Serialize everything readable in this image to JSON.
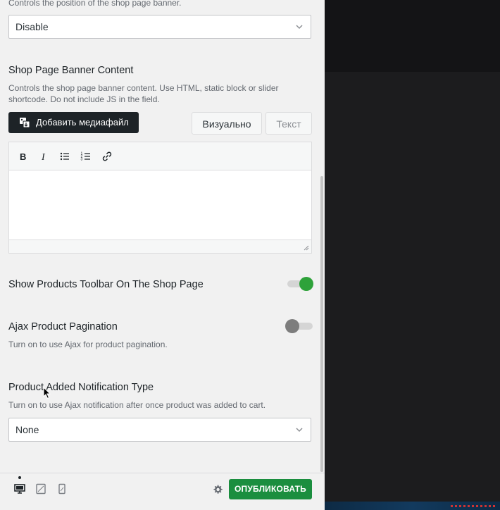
{
  "colors": {
    "accent_green": "#1b8e3f",
    "toggle_on": "#2ea23a",
    "toggle_off": "#7d7d7d"
  },
  "banner_position": {
    "description": "Controls the position of the shop page banner.",
    "value": "Disable"
  },
  "banner_content": {
    "title": "Shop Page Banner Content",
    "description": "Controls the shop page banner content. Use HTML, static block or slider shortcode. Do not include JS in the field.",
    "add_media_label": "Добавить медиафайл",
    "tab_visual": "Визуально",
    "tab_text": "Текст",
    "editor_value": "",
    "toolbar_icons": [
      "bold-icon",
      "italic-icon",
      "bulleted-list-icon",
      "numbered-list-icon",
      "link-icon"
    ]
  },
  "show_toolbar": {
    "title": "Show Products Toolbar On The Shop Page",
    "enabled": true
  },
  "ajax_pagination": {
    "title": "Ajax Product Pagination",
    "description": "Turn on to use Ajax for product pagination.",
    "enabled": false
  },
  "notification_type": {
    "title": "Product Added Notification Type",
    "description": "Turn on to use Ajax notification after once product was added to cart.",
    "value": "None"
  },
  "footer": {
    "devices": [
      "desktop-icon",
      "tablet-icon",
      "mobile-icon"
    ],
    "active_device": "desktop",
    "publish_label": "ОПУБЛИКОВАТЬ"
  }
}
